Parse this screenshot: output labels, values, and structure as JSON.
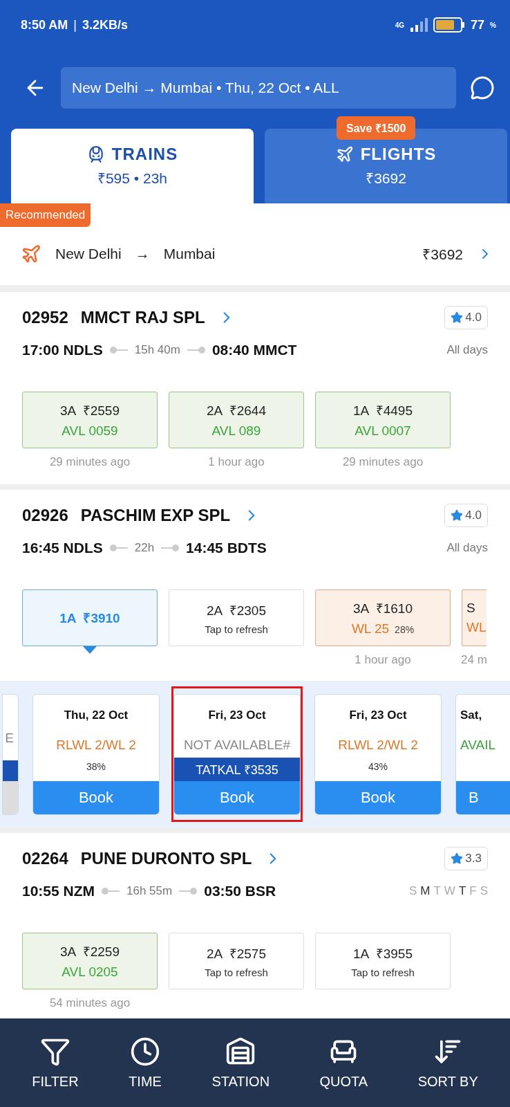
{
  "status_bar": {
    "time": "8:50 AM",
    "separator": "|",
    "speed": "3.2KB/s",
    "network": "4G",
    "battery": "77",
    "battery_unit": "%"
  },
  "header": {
    "search": "New Delhi → Mumbai • Thu, 22 Oct • ALL"
  },
  "tabs": [
    {
      "label": "TRAINS",
      "sub": "₹595 • 23h",
      "selected": true,
      "kind": "train"
    },
    {
      "label": "FLIGHTS",
      "sub": "₹3692",
      "selected": false,
      "kind": "flight",
      "badge": "Save ₹1500"
    }
  ],
  "recommended": {
    "badge": "Recommended",
    "from": "New Delhi",
    "arrow": "→",
    "to": "Mumbai",
    "price": "₹3692"
  },
  "trains": [
    {
      "number": "02952",
      "name": "MMCT RAJ SPL",
      "rating": "4.0",
      "dep": "17:00 NDLS",
      "duration": "15h 40m",
      "arr": "08:40 MMCT",
      "days_text": "All days",
      "classes": [
        {
          "kind": "avl",
          "selected": false,
          "fare": "3A  ₹2559",
          "status": "AVL 0059",
          "updated": "29 minutes ago"
        },
        {
          "kind": "avl",
          "selected": false,
          "fare": "2A  ₹2644",
          "status": "AVL 089",
          "updated": "1 hour ago"
        },
        {
          "kind": "avl",
          "selected": false,
          "fare": "1A  ₹4495",
          "status": "AVL 0007",
          "updated": "29 minutes ago"
        }
      ]
    },
    {
      "number": "02926",
      "name": "PASCHIM EXP SPL",
      "rating": "4.0",
      "dep": "16:45 NDLS",
      "duration": "22h",
      "arr": "14:45 BDTS",
      "days_text": "All days",
      "classes": [
        {
          "kind": "fare",
          "selected": true,
          "fare": "1A  ₹3910"
        },
        {
          "kind": "refresh",
          "selected": false,
          "fare": "2A  ₹2305",
          "status": "Tap to refresh"
        },
        {
          "kind": "wl",
          "selected": false,
          "fare": "3A  ₹1610",
          "status": "WL 25",
          "percent": "28%",
          "updated": "1 hour ago"
        },
        {
          "kind": "wl",
          "selected": false,
          "fare": "S",
          "status": "WL",
          "updated": "24 m"
        }
      ],
      "dates": [
        {
          "kind": "na",
          "status": "E"
        },
        {
          "date": "Thu, 22 Oct",
          "kind": "wl",
          "status": "RLWL 2/WL 2",
          "percent": "38%",
          "book": "Book",
          "highlighted": false
        },
        {
          "date": "Fri, 23 Oct",
          "kind": "na",
          "status": "NOT AVAILABLE#",
          "tatkal": "TATKAL ₹3535",
          "book": "Book",
          "highlighted": true
        },
        {
          "date": "Fri, 23 Oct",
          "kind": "wl",
          "status": "RLWL 2/WL 2",
          "percent": "43%",
          "book": "Book",
          "highlighted": false
        },
        {
          "date": "Sat,",
          "kind": "avl",
          "status": "AVAIL",
          "book": "B",
          "highlighted": false
        }
      ]
    },
    {
      "number": "02264",
      "name": "PUNE DURONTO SPL",
      "rating": "3.3",
      "dep": "10:55 NZM",
      "duration": "16h 55m",
      "arr": "03:50 BSR",
      "days": [
        {
          "letter": "S",
          "on": false
        },
        {
          "letter": "M",
          "on": true
        },
        {
          "letter": "T",
          "on": false
        },
        {
          "letter": "W",
          "on": false
        },
        {
          "letter": "T",
          "on": true
        },
        {
          "letter": "F",
          "on": false
        },
        {
          "letter": "S",
          "on": false
        }
      ],
      "classes": [
        {
          "kind": "avl",
          "selected": false,
          "fare": "3A  ₹2259",
          "status": "AVL 0205",
          "updated": "54 minutes ago"
        },
        {
          "kind": "refresh",
          "selected": false,
          "fare": "2A  ₹2575",
          "status": "Tap to refresh"
        },
        {
          "kind": "refresh",
          "selected": false,
          "fare": "1A  ₹3955",
          "status": "Tap to refresh"
        }
      ]
    }
  ],
  "bottom_nav": [
    {
      "label": "FILTER"
    },
    {
      "label": "TIME"
    },
    {
      "label": "STATION"
    },
    {
      "label": "QUOTA"
    },
    {
      "label": "SORT BY"
    }
  ]
}
